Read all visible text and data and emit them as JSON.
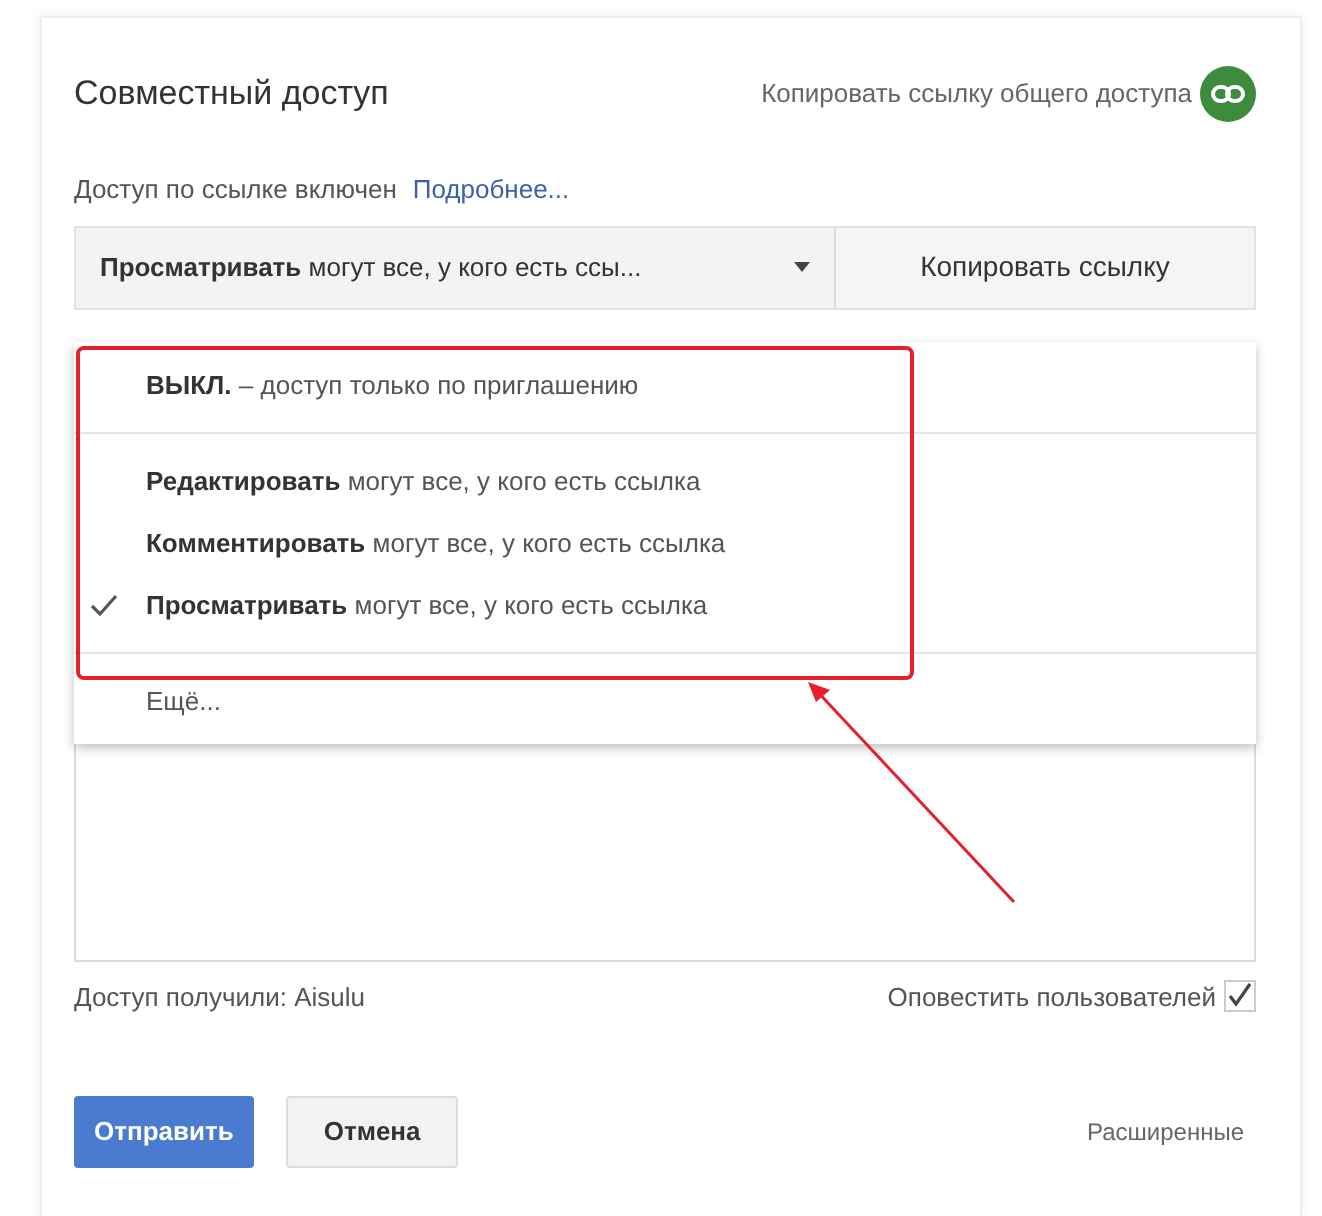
{
  "dialog": {
    "title": "Совместный доступ",
    "copy_share_link": "Копировать ссылку общего доступа"
  },
  "link_status": {
    "text": "Доступ по ссылке включен",
    "more_link": "Подробнее..."
  },
  "access_dropdown": {
    "value": "**Просматривать** могут все, у кого есть ссы...",
    "copy_button": "Копировать ссылку"
  },
  "menu": {
    "sections": [
      [
        {
          "label": "**ВЫКЛ.** – доступ только по приглашению",
          "selected": false
        }
      ],
      [
        {
          "label": "**Редактировать** могут все, у кого есть ссылка",
          "selected": false
        },
        {
          "label": "**Комментировать** могут все, у кого есть ссылка",
          "selected": false
        },
        {
          "label": "**Просматривать** могут все, у кого есть ссылка",
          "selected": true
        }
      ],
      [
        {
          "label": "Ещё...",
          "selected": false
        }
      ]
    ]
  },
  "annotation": {
    "kind": "highlight-with-arrow"
  },
  "access_granted": "Доступ получили: Aisulu",
  "notify": {
    "label": "Оповестить пользователей",
    "checked": true
  },
  "buttons": {
    "send": "Отправить",
    "cancel": "Отмена",
    "advanced": "Расширенные"
  }
}
